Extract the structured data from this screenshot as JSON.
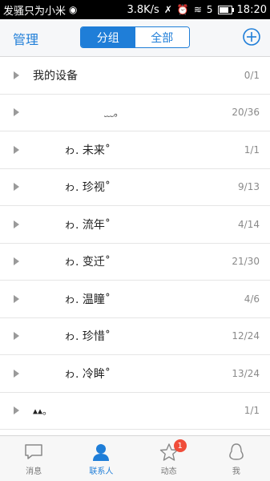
{
  "status_bar": {
    "carrier": "发骚只为小米",
    "speed": "3.8K/s",
    "time": "18:20",
    "signal": "5"
  },
  "header": {
    "manage_label": "管理",
    "tabs": [
      {
        "label": "分组",
        "active": true
      },
      {
        "label": "全部",
        "active": false
      }
    ],
    "add_icon": "plus-circle-icon"
  },
  "groups": [
    {
      "name": "我的设备",
      "count": "0/1"
    },
    {
      "name": "﹏。",
      "count": "20/36"
    },
    {
      "name": "ゎ. 未来˚",
      "count": "1/1"
    },
    {
      "name": "ゎ. 珍视˚",
      "count": "9/13"
    },
    {
      "name": "ゎ. 流年˚",
      "count": "4/14"
    },
    {
      "name": "ゎ. 变迁˚",
      "count": "21/30"
    },
    {
      "name": "ゎ. 温瞳˚",
      "count": "4/6"
    },
    {
      "name": "ゎ. 珍惜˚",
      "count": "12/24"
    },
    {
      "name": "ゎ. 冷眸˚",
      "count": "13/24"
    },
    {
      "name": "▴▴。",
      "count": "1/1"
    }
  ],
  "bottom_nav": [
    {
      "label": "消息",
      "icon": "message-icon",
      "active": false
    },
    {
      "label": "联系人",
      "icon": "contacts-icon",
      "active": true
    },
    {
      "label": "动态",
      "icon": "star-icon",
      "active": false,
      "badge": "1"
    },
    {
      "label": "我",
      "icon": "penguin-icon",
      "active": false
    }
  ],
  "colors": {
    "accent": "#1f7ed8",
    "badge": "#f04d3a"
  }
}
